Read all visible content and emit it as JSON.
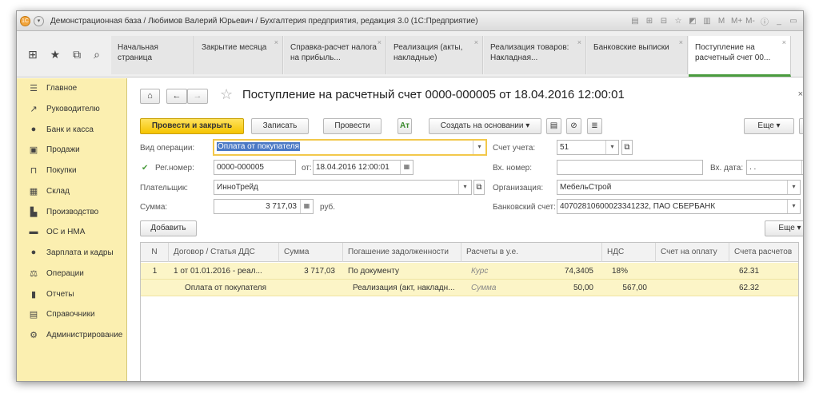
{
  "window": {
    "title": "Демонстрационная база / Любимов Валерий Юрьевич / Бухгалтерия предприятия, редакция 3.0  (1С:Предприятие)",
    "tools": [
      "▤",
      "⊞",
      "⊟",
      "☆",
      "◩",
      "▥",
      "M",
      "M+",
      "M-",
      "ⓘ",
      "_",
      "▭"
    ]
  },
  "tabs": [
    {
      "label": "Начальная страница"
    },
    {
      "label": "Закрытие месяца"
    },
    {
      "label": "Справка-расчет налога на прибыль..."
    },
    {
      "label": "Реализация (акты, накладные)"
    },
    {
      "label": "Реализация товаров: Накладная..."
    },
    {
      "label": "Банковские выписки"
    },
    {
      "label": "Поступление на расчетный счет 00..."
    }
  ],
  "sidebar": {
    "items": [
      {
        "label": "Главное",
        "icon": "☰"
      },
      {
        "label": "Руководителю",
        "icon": "↗"
      },
      {
        "label": "Банк и касса",
        "icon": "●"
      },
      {
        "label": "Продажи",
        "icon": "▣"
      },
      {
        "label": "Покупки",
        "icon": "⊓"
      },
      {
        "label": "Склад",
        "icon": "▦"
      },
      {
        "label": "Производство",
        "icon": "▙"
      },
      {
        "label": "ОС и НМА",
        "icon": "▬"
      },
      {
        "label": "Зарплата и кадры",
        "icon": "●"
      },
      {
        "label": "Операции",
        "icon": "⚖"
      },
      {
        "label": "Отчеты",
        "icon": "▮"
      },
      {
        "label": "Справочники",
        "icon": "▤"
      },
      {
        "label": "Администрирование",
        "icon": "⚙"
      }
    ]
  },
  "doc": {
    "title": "Поступление на расчетный счет 0000-000005 от 18.04.2016 12:00:01",
    "toolbar": {
      "post_close": "Провести и закрыть",
      "save": "Записать",
      "post": "Провести",
      "create_based": "Создать на основании",
      "more": "Еще",
      "help": "?"
    },
    "fields": {
      "operation_label": "Вид операции:",
      "operation_value": "Оплата от покупателя",
      "account_label": "Счет учета:",
      "account_value": "51",
      "regnum_label": "Рег.номер:",
      "regnum_value": "0000-000005",
      "from_label": "от:",
      "from_value": "18.04.2016 12:00:01",
      "in_num_label": "Вх. номер:",
      "in_num_value": "",
      "in_date_label": "Вх. дата:",
      "in_date_value": ". .",
      "payer_label": "Плательщик:",
      "payer_value": "ИнноТрейд",
      "org_label": "Организация:",
      "org_value": "МебельСтрой",
      "sum_label": "Сумма:",
      "sum_value": "3 717,03",
      "currency": "руб.",
      "bank_label": "Банковский счет:",
      "bank_value": "40702810600023341232, ПАО СБЕРБАНК"
    },
    "add_button": "Добавить",
    "table_more": "Еще",
    "table": {
      "columns": [
        "N",
        "Договор / Статья ДДС",
        "Сумма",
        "Погашение задолженности",
        "Расчеты в у.е.",
        "НДС",
        "Счет на оплату",
        "Счета расчетов"
      ],
      "rows": [
        {
          "n": "1",
          "contract": "1 от 01.01.2016 - реал...",
          "sum": "3 717,03",
          "repay": "По документу",
          "ue_label": "Курс",
          "ue_value": "74,3405",
          "vat": "18%",
          "vat_sum": "",
          "invoice": "",
          "accounts": "62.31"
        },
        {
          "n": "",
          "contract": "Оплата от покупателя",
          "sum": "",
          "repay": "Реализация (акт, накладн...",
          "ue_label": "Сумма",
          "ue_value": "50,00",
          "vat": "",
          "vat_sum": "567,00",
          "invoice": "",
          "accounts": "62.32"
        }
      ]
    }
  }
}
